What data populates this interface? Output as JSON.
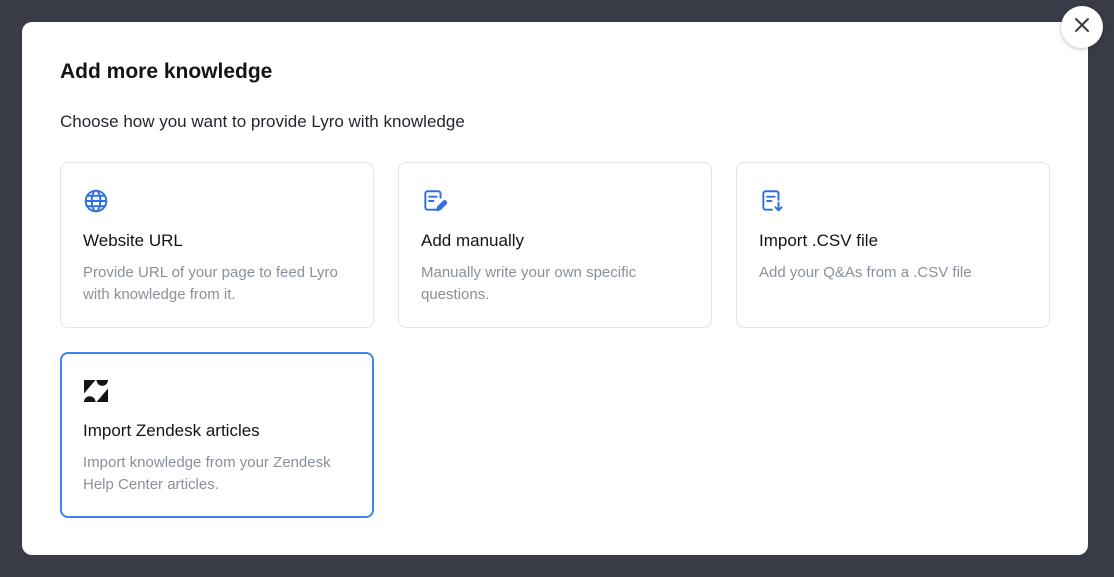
{
  "modal": {
    "title": "Add more knowledge",
    "subtitle": "Choose how you want to provide Lyro with knowledge",
    "close_icon": "close-icon"
  },
  "options": [
    {
      "icon": "globe-icon",
      "title": "Website URL",
      "description": "Provide URL of your page to feed Lyro with knowledge from it."
    },
    {
      "icon": "edit-document-icon",
      "title": "Add manually",
      "description": "Manually write your own specific questions."
    },
    {
      "icon": "import-file-icon",
      "title": "Import .CSV file",
      "description": "Add your Q&As from a .CSV file"
    },
    {
      "icon": "zendesk-logo-icon",
      "title": "Import Zendesk articles",
      "description": "Import knowledge from your Zendesk Help Center articles.",
      "selected": true
    }
  ],
  "colors": {
    "backdrop": "#393c47",
    "accent": "#3f84f0",
    "icon_blue": "#2f6fe4",
    "card_border": "#e2e5ea",
    "muted_text": "#8a909b"
  }
}
